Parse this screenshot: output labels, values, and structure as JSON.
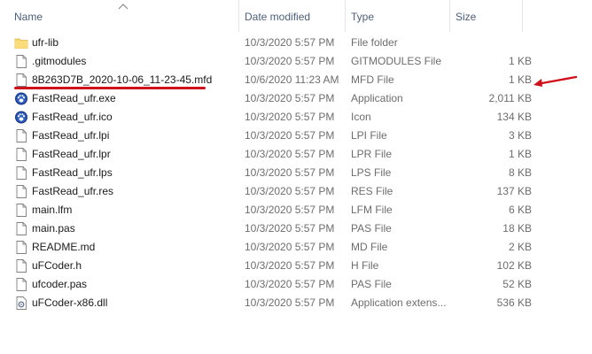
{
  "columns": {
    "name": "Name",
    "date": "Date modified",
    "type": "Type",
    "size": "Size"
  },
  "files": [
    {
      "name": "ufr-lib",
      "date": "10/3/2020 5:57 PM",
      "type": "File folder",
      "size": "",
      "icon": "folder-icon"
    },
    {
      "name": ".gitmodules",
      "date": "10/3/2020 5:57 PM",
      "type": "GITMODULES File",
      "size": "1 KB",
      "icon": "file-icon"
    },
    {
      "name": "8B263D7B_2020-10-06_11-23-45.mfd",
      "date": "10/6/2020 11:23 AM",
      "type": "MFD File",
      "size": "1 KB",
      "icon": "file-icon"
    },
    {
      "name": "FastRead_ufr.exe",
      "date": "10/3/2020 5:57 PM",
      "type": "Application",
      "size": "2,011 KB",
      "icon": "app-paw-icon"
    },
    {
      "name": "FastRead_ufr.ico",
      "date": "10/3/2020 5:57 PM",
      "type": "Icon",
      "size": "134 KB",
      "icon": "app-paw-icon"
    },
    {
      "name": "FastRead_ufr.lpi",
      "date": "10/3/2020 5:57 PM",
      "type": "LPI File",
      "size": "3 KB",
      "icon": "file-icon"
    },
    {
      "name": "FastRead_ufr.lpr",
      "date": "10/3/2020 5:57 PM",
      "type": "LPR File",
      "size": "1 KB",
      "icon": "file-icon"
    },
    {
      "name": "FastRead_ufr.lps",
      "date": "10/3/2020 5:57 PM",
      "type": "LPS File",
      "size": "8 KB",
      "icon": "file-icon"
    },
    {
      "name": "FastRead_ufr.res",
      "date": "10/3/2020 5:57 PM",
      "type": "RES File",
      "size": "137 KB",
      "icon": "file-icon"
    },
    {
      "name": "main.lfm",
      "date": "10/3/2020 5:57 PM",
      "type": "LFM File",
      "size": "6 KB",
      "icon": "file-icon"
    },
    {
      "name": "main.pas",
      "date": "10/3/2020 5:57 PM",
      "type": "PAS File",
      "size": "18 KB",
      "icon": "file-icon"
    },
    {
      "name": "README.md",
      "date": "10/3/2020 5:57 PM",
      "type": "MD File",
      "size": "2 KB",
      "icon": "file-icon"
    },
    {
      "name": "uFCoder.h",
      "date": "10/3/2020 5:57 PM",
      "type": "H File",
      "size": "102 KB",
      "icon": "file-icon"
    },
    {
      "name": "ufcoder.pas",
      "date": "10/3/2020 5:57 PM",
      "type": "PAS File",
      "size": "52 KB",
      "icon": "file-icon"
    },
    {
      "name": "uFCoder-x86.dll",
      "date": "10/3/2020 5:57 PM",
      "type": "Application extens...",
      "size": "536 KB",
      "icon": "dll-gear-icon"
    }
  ],
  "annotation_color": "#d0101a"
}
